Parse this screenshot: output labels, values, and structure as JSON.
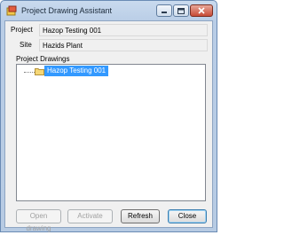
{
  "window": {
    "title": "Project Drawing Assistant",
    "icon": "app-icon",
    "controls": [
      "minimize-icon",
      "maximize-icon",
      "close-icon"
    ]
  },
  "form": {
    "project_label": "Project",
    "project_value": "Hazop Testing 001",
    "site_label": "Site",
    "site_value": "Hazids Plant",
    "drawings_label": "Project Drawings"
  },
  "tree": {
    "nodes": [
      {
        "label": "Hazop Testing 001",
        "icon": "folder-icon",
        "selected": true
      }
    ]
  },
  "buttons": {
    "open_drawing": "Open drawing",
    "activate": "Activate",
    "refresh": "Refresh",
    "close": "Close"
  },
  "colors": {
    "selection": "#3399ff",
    "title_bar": "#c9daee",
    "dialog_background": "#f0f0f0"
  }
}
